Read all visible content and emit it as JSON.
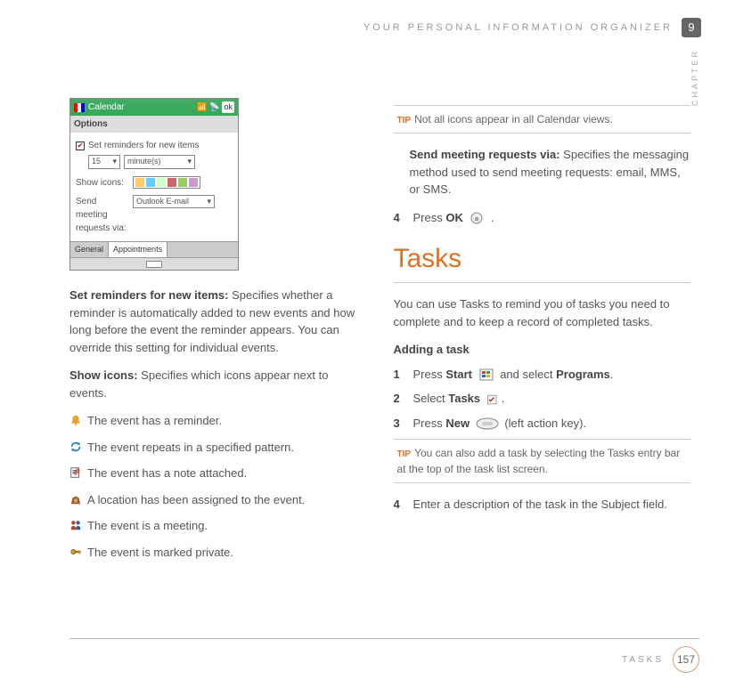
{
  "header": {
    "title": "YOUR PERSONAL INFORMATION ORGANIZER",
    "chapter_num": "9",
    "chapter_label": "CHAPTER"
  },
  "calendar_shot": {
    "app": "Calendar",
    "ok": "ok",
    "options": "Options",
    "set_reminders": "Set reminders for new items",
    "reminder_value": "15",
    "reminder_unit": "minute(s)",
    "show_icons": "Show icons:",
    "send_meeting": "Send meeting requests via:",
    "send_value": "Outlook E-mail",
    "tab_general": "General",
    "tab_appts": "Appointments"
  },
  "left": {
    "p1_b": "Set reminders for new items:",
    "p1": " Specifies whether a reminder is automatically added to new events and how long before the event the reminder appears. You can override this setting for individual events.",
    "p2_b": "Show icons:",
    "p2": " Specifies which icons appear next to events.",
    "icons": [
      {
        "name": "reminder-icon",
        "text": "The event has a reminder."
      },
      {
        "name": "repeat-icon",
        "text": "The event repeats in a specified pattern."
      },
      {
        "name": "note-icon",
        "text": "The event has a note attached."
      },
      {
        "name": "location-icon",
        "text": "A location has been assigned to the event."
      },
      {
        "name": "meeting-icon",
        "text": "The event is a meeting."
      },
      {
        "name": "private-icon",
        "text": "The event is marked private."
      }
    ]
  },
  "right": {
    "tip1_label": "TIP",
    "tip1": "Not all icons appear in all Calendar views.",
    "p1_b": "Send meeting requests via:",
    "p1": " Specifies the messaging method used to send meeting requests: email, MMS, or SMS.",
    "step4a_num": "4",
    "step4a_pre": "Press ",
    "step4a_b": "OK",
    "step4a_post": " .",
    "section": "Tasks",
    "intro": "You can use Tasks to remind you of tasks you need to complete and to keep a record of completed tasks.",
    "adding": "Adding a task",
    "s1_num": "1",
    "s1_pre": "Press ",
    "s1_b1": "Start",
    "s1_mid": " and select ",
    "s1_b2": "Programs",
    "s1_post": ".",
    "s2_num": "2",
    "s2_pre": "Select ",
    "s2_b": "Tasks",
    "s2_post": ".",
    "s3_num": "3",
    "s3_pre": "Press ",
    "s3_b": "New",
    "s3_post": " (left action key).",
    "tip2_label": "TIP",
    "tip2": "You can also add a task by selecting the Tasks entry bar at the top of the task list screen.",
    "s4_num": "4",
    "s4": "Enter a description of the task in the Subject field."
  },
  "footer": {
    "label": "TASKS",
    "page": "157"
  }
}
